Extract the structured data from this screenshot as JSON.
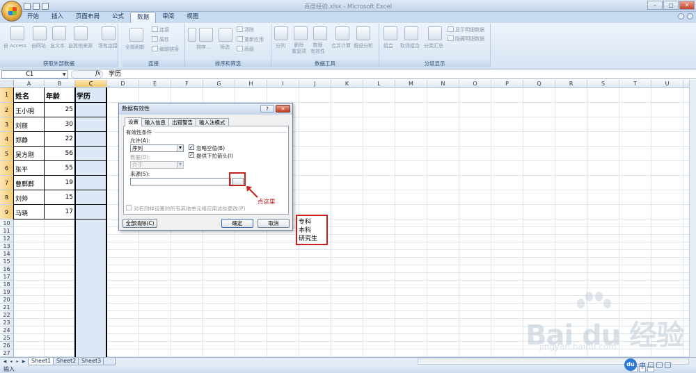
{
  "window": {
    "title": "百度经验.xlsx - Microsoft Excel",
    "min": "–",
    "max": "▢",
    "close": "✕"
  },
  "ribbon_tabs": [
    "开始",
    "插入",
    "页面布局",
    "公式",
    "数据",
    "审阅",
    "视图"
  ],
  "active_tab": "数据",
  "ribbon": {
    "get_external": {
      "label": "获取外部数据",
      "items": [
        "自 Access",
        "自网站",
        "自文本",
        "自其他来源",
        "现有连接"
      ]
    },
    "connections": {
      "label": "连接",
      "refresh": "全部刷新",
      "items": [
        "连接",
        "属性",
        "编辑链接"
      ]
    },
    "sort_filter": {
      "label": "排序和筛选",
      "sort": "排序...",
      "filter": "筛选",
      "items": [
        "清除",
        "重新应用",
        "高级"
      ]
    },
    "data_tools": {
      "label": "数据工具",
      "items": [
        "分列",
        "删除\n重复项",
        "数据\n有效性",
        "合并计算",
        "假设分析"
      ]
    },
    "outline": {
      "label": "分级显示",
      "items": [
        "组合",
        "取消组合",
        "分类汇总"
      ],
      "side": [
        "显示明细数据",
        "隐藏明细数据"
      ]
    }
  },
  "formula_bar": {
    "name_box": "C1",
    "fx": "fx",
    "content": "学历"
  },
  "columns": [
    "A",
    "B",
    "C",
    "D",
    "E",
    "F",
    "G",
    "H",
    "I",
    "J",
    "K",
    "L",
    "M",
    "N",
    "O",
    "P",
    "Q",
    "R",
    "S",
    "T",
    "U",
    "V"
  ],
  "rows": [
    "1",
    "2",
    "3",
    "4",
    "5",
    "6",
    "7",
    "8",
    "9",
    "10",
    "11",
    "12",
    "13",
    "14",
    "15",
    "16",
    "17",
    "18",
    "19",
    "20",
    "21",
    "22",
    "23",
    "24",
    "25",
    "26",
    "27",
    "28"
  ],
  "table": {
    "headers": [
      "姓名",
      "年龄",
      "学历"
    ],
    "rows": [
      [
        "王小明",
        "25"
      ],
      [
        "刘丽",
        "30"
      ],
      [
        "郑静",
        "22"
      ],
      [
        "吴方刚",
        "56"
      ],
      [
        "张平",
        "55"
      ],
      [
        "曹鄜鄜",
        "19"
      ],
      [
        "刘帅",
        "15"
      ],
      [
        "马晓",
        "17"
      ]
    ]
  },
  "dialog": {
    "title": "数据有效性",
    "help": "?",
    "close": "✕",
    "tabs": [
      "设置",
      "输入信息",
      "出错警告",
      "输入法模式"
    ],
    "group_label": "有效性条件",
    "allow_label": "允许(A):",
    "allow_value": "序列",
    "ignore_blank": "忽略空值(B)",
    "dropdown": "提供下拉箭头(I)",
    "data_label": "数据(D):",
    "data_value": "介于",
    "source_label": "来源(S):",
    "apply_all": "对有同样设置的所有其他单元格应用这些更改(P)",
    "clear_all": "全部清除(C)",
    "ok": "确定",
    "cancel": "取消"
  },
  "annotation": "点这里",
  "list_values": [
    "专科",
    "本科",
    "研究生"
  ],
  "sheets": [
    "Sheet1",
    "Sheet2",
    "Sheet3"
  ],
  "status": "输入",
  "watermark": {
    "logo": "Bai du 经验",
    "url": "jingyan.baidu.com"
  },
  "ime": {
    "badge": "du",
    "lang": "中"
  },
  "colors": {
    "ribbon": "#d7e4f3",
    "selection": "#f5c96a",
    "highlight": "#c62020",
    "title": "#c5d6ec"
  }
}
